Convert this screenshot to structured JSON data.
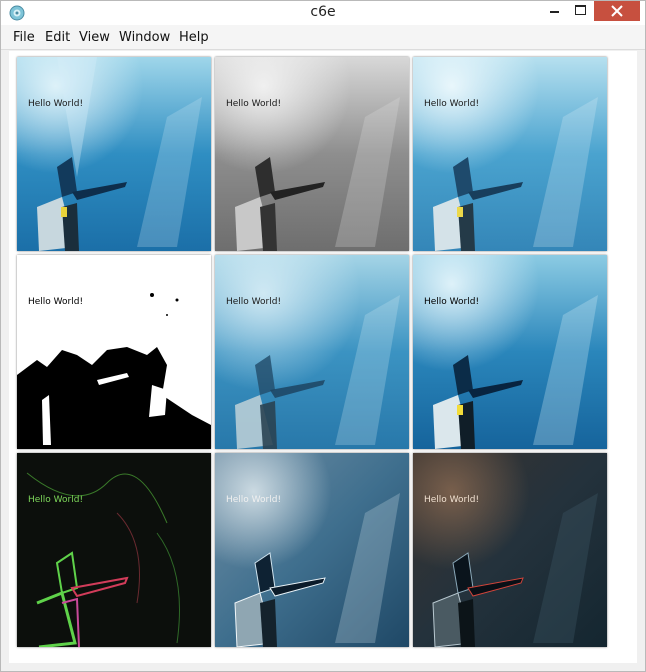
{
  "window": {
    "title": "c6e"
  },
  "menu": [
    "File",
    "Edit",
    "View",
    "Window",
    "Help"
  ],
  "tiles": [
    {
      "name": "original",
      "caption": "Hello World!",
      "caption_color": "#1a1a1a"
    },
    {
      "name": "grayscale",
      "caption": "Hello World!",
      "caption_color": "#1a1a1a"
    },
    {
      "name": "brightened",
      "caption": "Hello World!",
      "caption_color": "#1a1a1a"
    },
    {
      "name": "threshold",
      "caption": "Hello World!",
      "caption_color": "#000000"
    },
    {
      "name": "blurred",
      "caption": "Hello World!",
      "caption_color": "#1a1a1a"
    },
    {
      "name": "sharpened",
      "caption": "Hello World!",
      "caption_color": "#000000"
    },
    {
      "name": "edge-detect",
      "caption": "Hello World!",
      "caption_color": "#7dd65a"
    },
    {
      "name": "emboss-light",
      "caption": "Hello World!",
      "caption_color": "#f0f0f0"
    },
    {
      "name": "emboss-dark",
      "caption": "Hello World!",
      "caption_color": "#f0e0d0"
    }
  ]
}
